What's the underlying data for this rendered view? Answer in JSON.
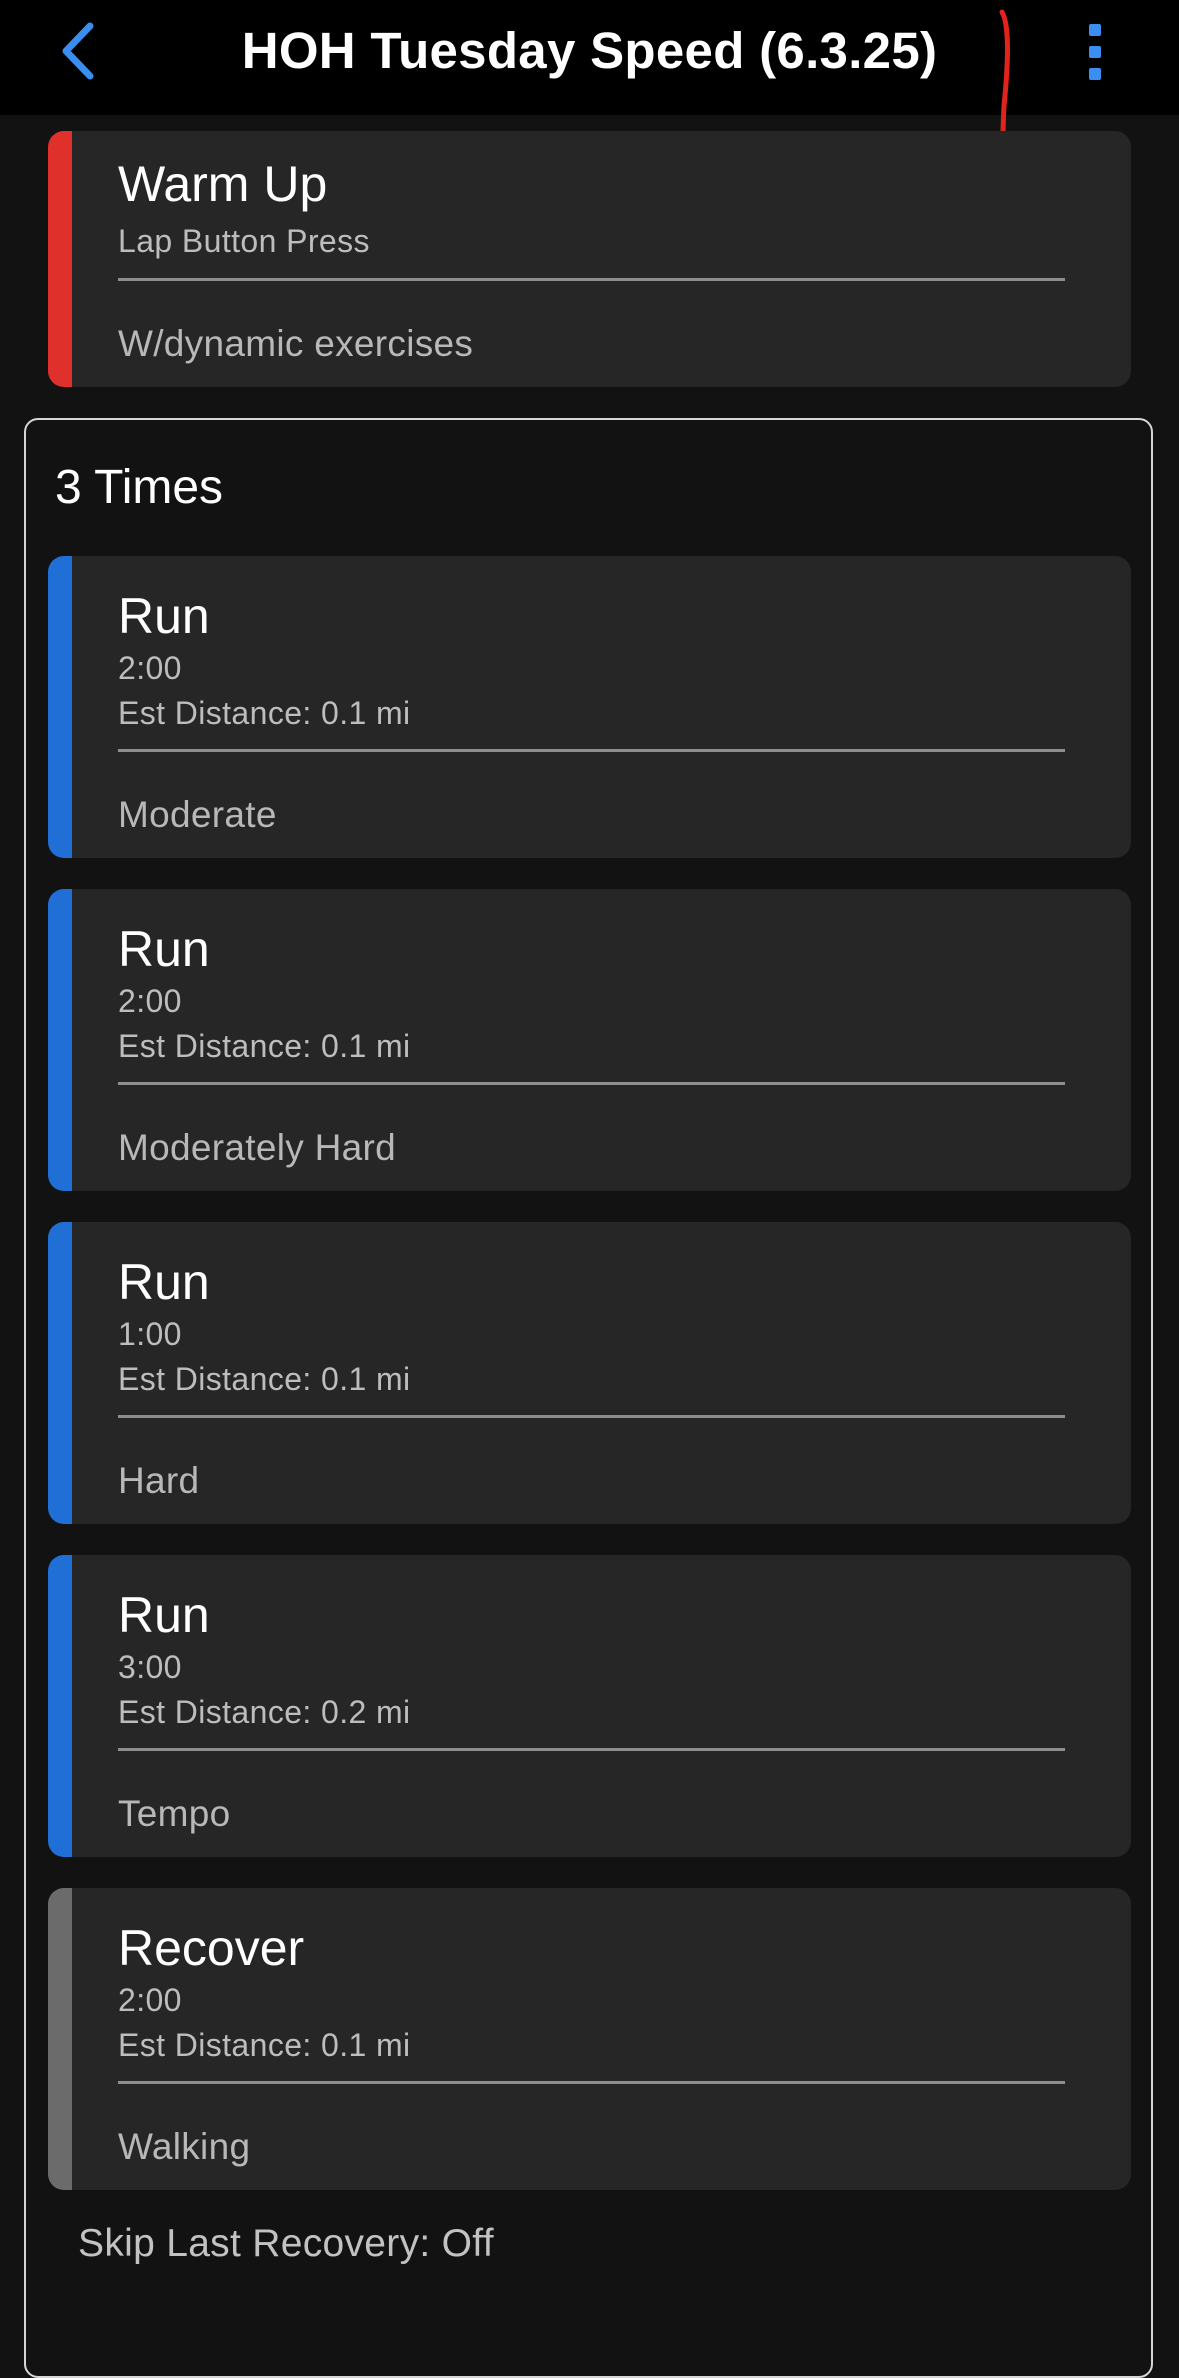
{
  "header": {
    "title": "HOH Tuesday Speed (6.3.25)",
    "back_icon": "chevron-left-icon",
    "menu_icon": "more-vertical-icon",
    "accent_color": "#3a8ef0"
  },
  "warmup": {
    "title": "Warm Up",
    "duration": "Lap Button Press",
    "note": "W/dynamic exercises",
    "color": "#e0302b"
  },
  "repeat": {
    "label": "3 Times",
    "steps": [
      {
        "title": "Run",
        "duration": "2:00",
        "distance": "Est Distance: 0.1 mi",
        "note": "Moderate",
        "color": "#1f6fd6"
      },
      {
        "title": "Run",
        "duration": "2:00",
        "distance": "Est Distance: 0.1 mi",
        "note": "Moderately Hard",
        "color": "#1f6fd6"
      },
      {
        "title": "Run",
        "duration": "1:00",
        "distance": "Est Distance: 0.1 mi",
        "note": "Hard",
        "color": "#1f6fd6"
      },
      {
        "title": "Run",
        "duration": "3:00",
        "distance": "Est Distance: 0.2 mi",
        "note": "Tempo",
        "color": "#1f6fd6"
      },
      {
        "title": "Recover",
        "duration": "2:00",
        "distance": "Est Distance: 0.1 mi",
        "note": "Walking",
        "color": "#6b6b6b"
      }
    ],
    "skip_last_recovery": "Skip Last Recovery: Off"
  },
  "colors": {
    "background": "#121212",
    "card": "#262626",
    "header_bg": "#000000",
    "annotation_mark": "#e0241c"
  }
}
